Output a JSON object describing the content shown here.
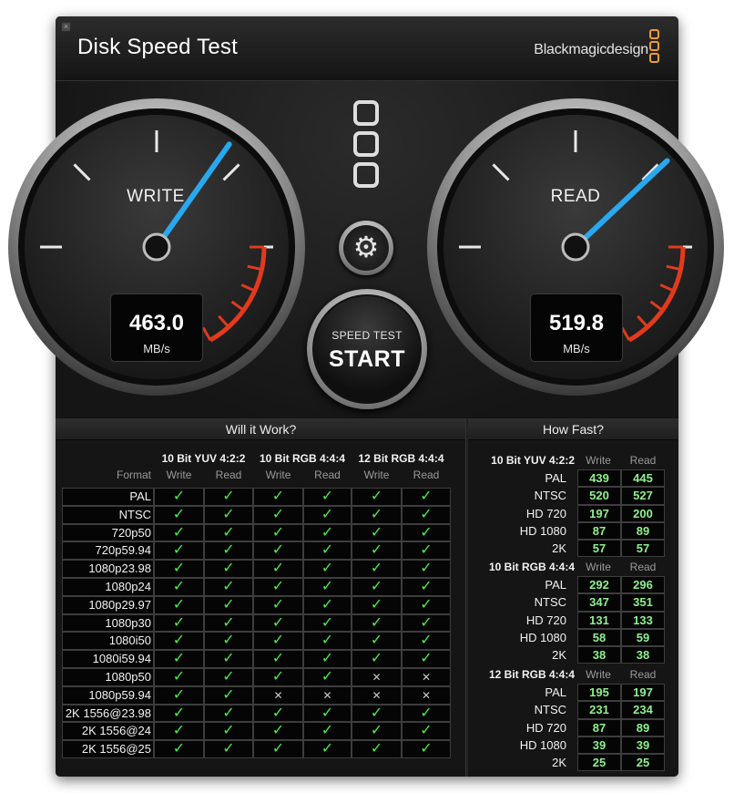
{
  "window": {
    "close_icon": "×",
    "title": "Disk Speed Test",
    "brand": "Blackmagicdesign",
    "brand_color": "#f19d2a"
  },
  "gauges": {
    "write": {
      "label": "WRITE",
      "value": "463.0",
      "unit": "MB/s",
      "reading": 463.0
    },
    "read": {
      "label": "READ",
      "value": "519.8",
      "unit": "MB/s",
      "reading": 519.8
    },
    "needle_color": "#29a8ef",
    "redline_color": "#e23a1d"
  },
  "controls": {
    "speed_test_label": "SPEED TEST",
    "start_label": "START",
    "settings_icon": "gear-icon"
  },
  "will_it_work": {
    "header": "Will it Work?",
    "format_label": "Format",
    "groups": [
      {
        "name": "10 Bit YUV 4:2:2",
        "cols": [
          "Write",
          "Read"
        ]
      },
      {
        "name": "10 Bit RGB 4:4:4",
        "cols": [
          "Write",
          "Read"
        ]
      },
      {
        "name": "12 Bit RGB 4:4:4",
        "cols": [
          "Write",
          "Read"
        ]
      }
    ],
    "rows": [
      {
        "format": "PAL",
        "ok": [
          1,
          1,
          1,
          1,
          1,
          1
        ]
      },
      {
        "format": "NTSC",
        "ok": [
          1,
          1,
          1,
          1,
          1,
          1
        ]
      },
      {
        "format": "720p50",
        "ok": [
          1,
          1,
          1,
          1,
          1,
          1
        ]
      },
      {
        "format": "720p59.94",
        "ok": [
          1,
          1,
          1,
          1,
          1,
          1
        ]
      },
      {
        "format": "1080p23.98",
        "ok": [
          1,
          1,
          1,
          1,
          1,
          1
        ]
      },
      {
        "format": "1080p24",
        "ok": [
          1,
          1,
          1,
          1,
          1,
          1
        ]
      },
      {
        "format": "1080p29.97",
        "ok": [
          1,
          1,
          1,
          1,
          1,
          1
        ]
      },
      {
        "format": "1080p30",
        "ok": [
          1,
          1,
          1,
          1,
          1,
          1
        ]
      },
      {
        "format": "1080i50",
        "ok": [
          1,
          1,
          1,
          1,
          1,
          1
        ]
      },
      {
        "format": "1080i59.94",
        "ok": [
          1,
          1,
          1,
          1,
          1,
          1
        ]
      },
      {
        "format": "1080p50",
        "ok": [
          1,
          1,
          1,
          1,
          0,
          0
        ]
      },
      {
        "format": "1080p59.94",
        "ok": [
          1,
          1,
          0,
          0,
          0,
          0
        ]
      },
      {
        "format": "2K 1556@23.98",
        "ok": [
          1,
          1,
          1,
          1,
          1,
          1
        ]
      },
      {
        "format": "2K 1556@24",
        "ok": [
          1,
          1,
          1,
          1,
          1,
          1
        ]
      },
      {
        "format": "2K 1556@25",
        "ok": [
          1,
          1,
          1,
          1,
          1,
          1
        ]
      }
    ],
    "check_symbol": "✓",
    "cross_symbol": "✕",
    "check_color": "#4ee94e"
  },
  "how_fast": {
    "header": "How Fast?",
    "write_label": "Write",
    "read_label": "Read",
    "groups": [
      {
        "name": "10 Bit YUV 4:2:2",
        "rows": [
          {
            "format": "PAL",
            "write": "439",
            "read": "445"
          },
          {
            "format": "NTSC",
            "write": "520",
            "read": "527"
          },
          {
            "format": "HD 720",
            "write": "197",
            "read": "200"
          },
          {
            "format": "HD 1080",
            "write": "87",
            "read": "89"
          },
          {
            "format": "2K",
            "write": "57",
            "read": "57"
          }
        ]
      },
      {
        "name": "10 Bit RGB 4:4:4",
        "rows": [
          {
            "format": "PAL",
            "write": "292",
            "read": "296"
          },
          {
            "format": "NTSC",
            "write": "347",
            "read": "351"
          },
          {
            "format": "HD 720",
            "write": "131",
            "read": "133"
          },
          {
            "format": "HD 1080",
            "write": "58",
            "read": "59"
          },
          {
            "format": "2K",
            "write": "38",
            "read": "38"
          }
        ]
      },
      {
        "name": "12 Bit RGB 4:4:4",
        "rows": [
          {
            "format": "PAL",
            "write": "195",
            "read": "197"
          },
          {
            "format": "NTSC",
            "write": "231",
            "read": "234"
          },
          {
            "format": "HD 720",
            "write": "87",
            "read": "89"
          },
          {
            "format": "HD 1080",
            "write": "39",
            "read": "39"
          },
          {
            "format": "2K",
            "write": "25",
            "read": "25"
          }
        ]
      }
    ],
    "value_color": "#8ff08f"
  }
}
